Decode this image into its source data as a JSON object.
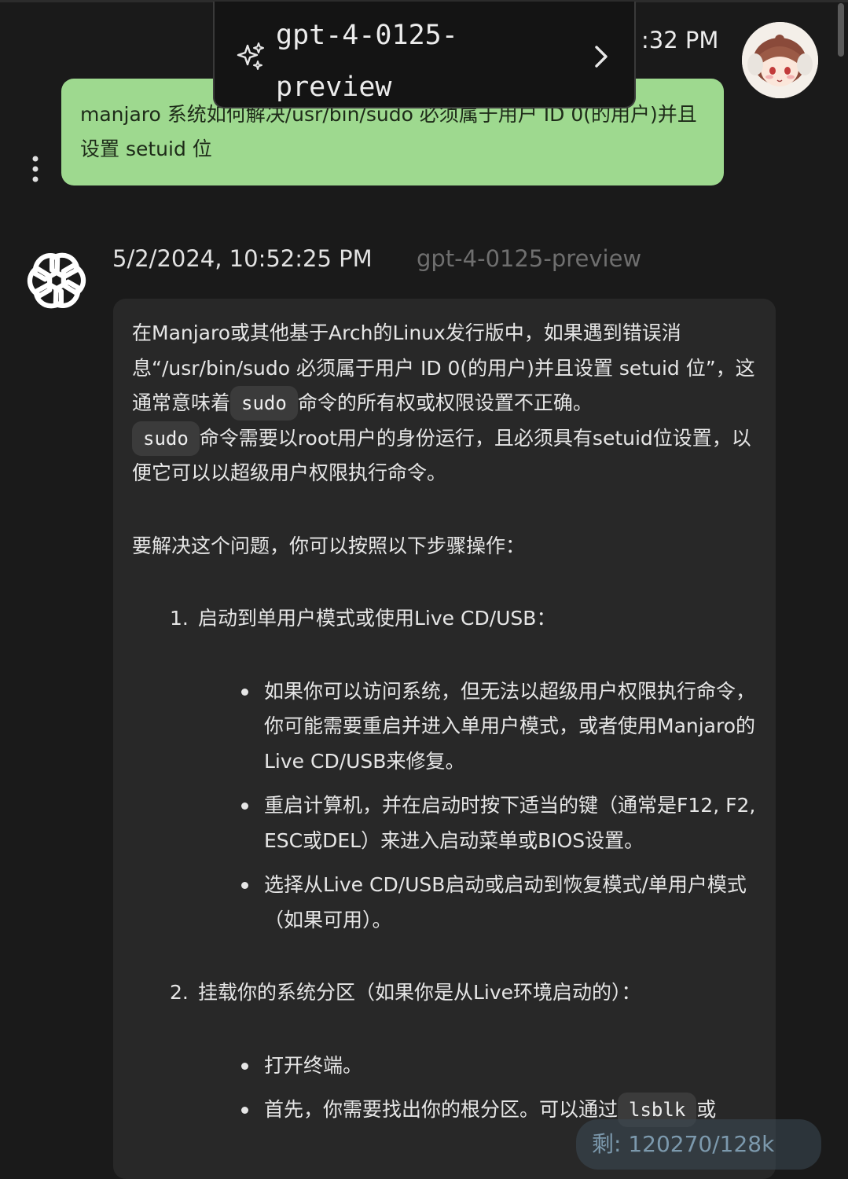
{
  "model_popup": {
    "icon": "sparkle-icon",
    "model_name": "gpt-4-0125-\npreview",
    "arrow_icon": "chevron-right-icon"
  },
  "user_message": {
    "time": ":32 PM",
    "text": "manjaro 系统如何解决/usr/bin/sudo 必须属于用户 ID 0(的用户)并且设置 setuid 位",
    "bubble_color": "#9ed98f"
  },
  "assistant_message": {
    "timestamp": "5/2/2024, 10:52:25 PM",
    "model": "gpt-4-0125-preview",
    "intro": {
      "part1": "在Manjaro或其他基于Arch的Linux发行版中，如果遇到错误消息“/usr/bin/sudo 必须属于用户 ID 0(的用户)并且设置 setuid 位”，这通常意味着",
      "code1": "sudo",
      "part2": "命令的所有权或权限设置不正确。",
      "code2": "sudo",
      "part3": "命令需要以root用户的身份运行，且必须具有setuid位设置，以便它可以以超级用户权限执行命令。"
    },
    "steps_intro": "要解决这个问题，你可以按照以下步骤操作：",
    "steps": [
      {
        "number": "1.",
        "title": "启动到单用户模式或使用Live CD/USB：",
        "bullets": [
          "如果你可以访问系统，但无法以超级用户权限执行命令，你可能需要重启并进入单用户模式，或者使用Manjaro的Live CD/USB来修复。",
          "重启计算机，并在启动时按下适当的键（通常是F12, F2, ESC或DEL）来进入启动菜单或BIOS设置。",
          "选择从Live CD/USB启动或启动到恢复模式/单用户模式（如果可用）。"
        ]
      },
      {
        "number": "2.",
        "title": "挂载你的系统分区（如果你是从Live环境启动的）：",
        "bullets": [
          "打开终端。"
        ],
        "last_bullet": {
          "part1": "首先，你需要找出你的根分区。可以通过",
          "code": "lsblk",
          "part2": "或"
        }
      }
    ]
  },
  "token_badge": "剩: 120270/128k"
}
